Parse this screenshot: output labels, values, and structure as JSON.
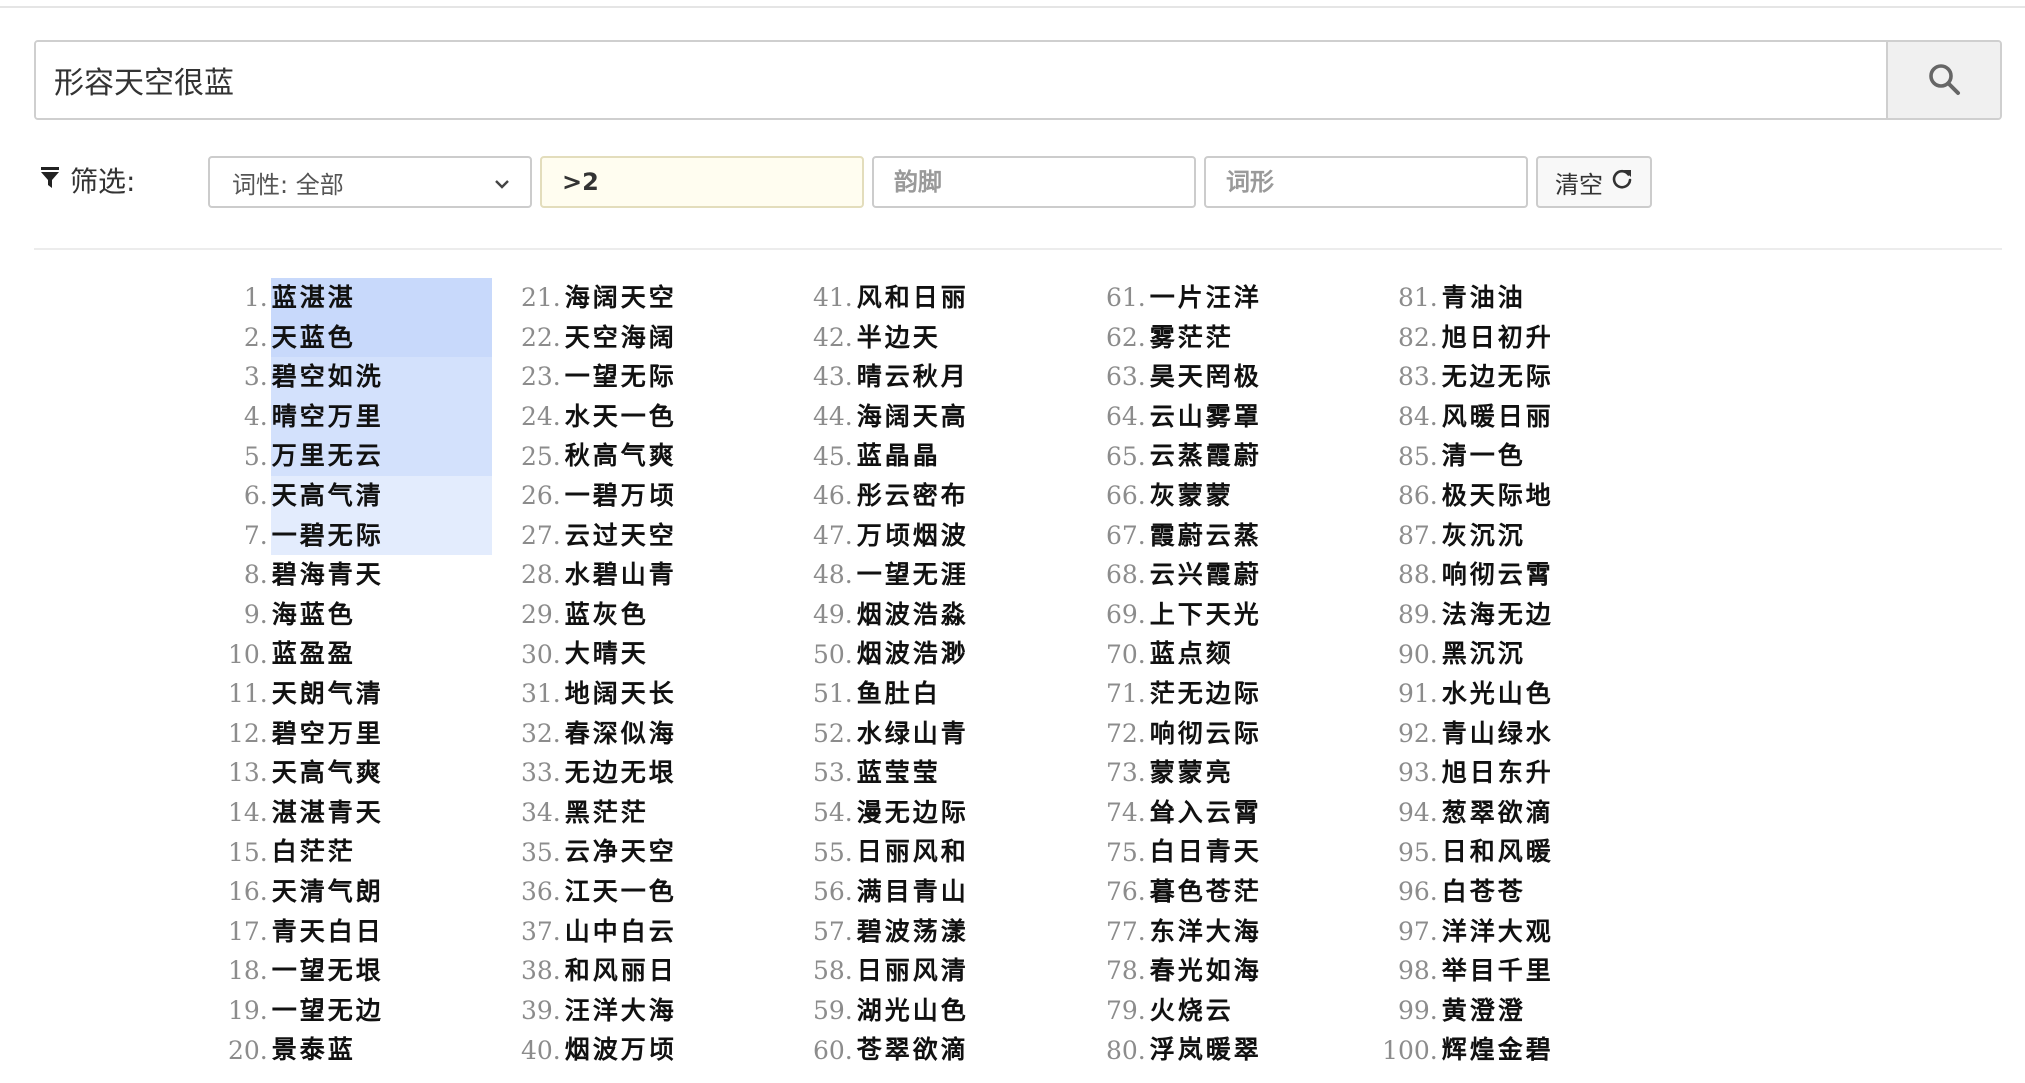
{
  "search": {
    "value": "形容天空很蓝",
    "button_icon": "search-icon"
  },
  "filter": {
    "label": "筛选:",
    "label_icon": "funnel-icon",
    "pos_select": {
      "selected": "词性: 全部"
    },
    "length_input": {
      "value": ">2",
      "placeholder": ""
    },
    "rhyme_input": {
      "value": "",
      "placeholder": "韵脚"
    },
    "form_input": {
      "value": "",
      "placeholder": "词形"
    },
    "clear_button": {
      "label": "清空",
      "icon": "refresh-icon"
    }
  },
  "colors": {
    "highlight_strong": "#c8d9fb",
    "highlight_medium": "#d3e1fc",
    "highlight_light": "#e3ecfd",
    "length_input_bg": "#fffdf0"
  },
  "results": [
    {
      "num": "1.",
      "word": "蓝湛湛",
      "hl": "strong"
    },
    {
      "num": "2.",
      "word": "天蓝色",
      "hl": "strong"
    },
    {
      "num": "3.",
      "word": "碧空如洗",
      "hl": "medium"
    },
    {
      "num": "4.",
      "word": "晴空万里",
      "hl": "medium"
    },
    {
      "num": "5.",
      "word": "万里无云",
      "hl": "medium"
    },
    {
      "num": "6.",
      "word": "天高气清",
      "hl": "light"
    },
    {
      "num": "7.",
      "word": "一碧无际",
      "hl": "light"
    },
    {
      "num": "8.",
      "word": "碧海青天"
    },
    {
      "num": "9.",
      "word": "海蓝色"
    },
    {
      "num": "10.",
      "word": "蓝盈盈"
    },
    {
      "num": "11.",
      "word": "天朗气清"
    },
    {
      "num": "12.",
      "word": "碧空万里"
    },
    {
      "num": "13.",
      "word": "天高气爽"
    },
    {
      "num": "14.",
      "word": "湛湛青天"
    },
    {
      "num": "15.",
      "word": "白茫茫"
    },
    {
      "num": "16.",
      "word": "天清气朗"
    },
    {
      "num": "17.",
      "word": "青天白日"
    },
    {
      "num": "18.",
      "word": "一望无垠"
    },
    {
      "num": "19.",
      "word": "一望无边"
    },
    {
      "num": "20.",
      "word": "景泰蓝"
    },
    {
      "num": "21.",
      "word": "海阔天空"
    },
    {
      "num": "22.",
      "word": "天空海阔"
    },
    {
      "num": "23.",
      "word": "一望无际"
    },
    {
      "num": "24.",
      "word": "水天一色"
    },
    {
      "num": "25.",
      "word": "秋高气爽"
    },
    {
      "num": "26.",
      "word": "一碧万顷"
    },
    {
      "num": "27.",
      "word": "云过天空"
    },
    {
      "num": "28.",
      "word": "水碧山青"
    },
    {
      "num": "29.",
      "word": "蓝灰色"
    },
    {
      "num": "30.",
      "word": "大晴天"
    },
    {
      "num": "31.",
      "word": "地阔天长"
    },
    {
      "num": "32.",
      "word": "春深似海"
    },
    {
      "num": "33.",
      "word": "无边无垠"
    },
    {
      "num": "34.",
      "word": "黑茫茫"
    },
    {
      "num": "35.",
      "word": "云净天空"
    },
    {
      "num": "36.",
      "word": "江天一色"
    },
    {
      "num": "37.",
      "word": "山中白云"
    },
    {
      "num": "38.",
      "word": "和风丽日"
    },
    {
      "num": "39.",
      "word": "汪洋大海"
    },
    {
      "num": "40.",
      "word": "烟波万顷"
    },
    {
      "num": "41.",
      "word": "风和日丽"
    },
    {
      "num": "42.",
      "word": "半边天"
    },
    {
      "num": "43.",
      "word": "晴云秋月"
    },
    {
      "num": "44.",
      "word": "海阔天高"
    },
    {
      "num": "45.",
      "word": "蓝晶晶"
    },
    {
      "num": "46.",
      "word": "彤云密布"
    },
    {
      "num": "47.",
      "word": "万顷烟波"
    },
    {
      "num": "48.",
      "word": "一望无涯"
    },
    {
      "num": "49.",
      "word": "烟波浩淼"
    },
    {
      "num": "50.",
      "word": "烟波浩渺"
    },
    {
      "num": "51.",
      "word": "鱼肚白"
    },
    {
      "num": "52.",
      "word": "水绿山青"
    },
    {
      "num": "53.",
      "word": "蓝莹莹"
    },
    {
      "num": "54.",
      "word": "漫无边际"
    },
    {
      "num": "55.",
      "word": "日丽风和"
    },
    {
      "num": "56.",
      "word": "满目青山"
    },
    {
      "num": "57.",
      "word": "碧波荡漾"
    },
    {
      "num": "58.",
      "word": "日丽风清"
    },
    {
      "num": "59.",
      "word": "湖光山色"
    },
    {
      "num": "60.",
      "word": "苍翠欲滴"
    },
    {
      "num": "61.",
      "word": "一片汪洋"
    },
    {
      "num": "62.",
      "word": "雾茫茫"
    },
    {
      "num": "63.",
      "word": "昊天罔极"
    },
    {
      "num": "64.",
      "word": "云山雾罩"
    },
    {
      "num": "65.",
      "word": "云蒸霞蔚"
    },
    {
      "num": "66.",
      "word": "灰蒙蒙"
    },
    {
      "num": "67.",
      "word": "霞蔚云蒸"
    },
    {
      "num": "68.",
      "word": "云兴霞蔚"
    },
    {
      "num": "69.",
      "word": "上下天光"
    },
    {
      "num": "70.",
      "word": "蓝点颏"
    },
    {
      "num": "71.",
      "word": "茫无边际"
    },
    {
      "num": "72.",
      "word": "响彻云际"
    },
    {
      "num": "73.",
      "word": "蒙蒙亮"
    },
    {
      "num": "74.",
      "word": "耸入云霄"
    },
    {
      "num": "75.",
      "word": "白日青天"
    },
    {
      "num": "76.",
      "word": "暮色苍茫"
    },
    {
      "num": "77.",
      "word": "东洋大海"
    },
    {
      "num": "78.",
      "word": "春光如海"
    },
    {
      "num": "79.",
      "word": "火烧云"
    },
    {
      "num": "80.",
      "word": "浮岚暖翠"
    },
    {
      "num": "81.",
      "word": "青油油"
    },
    {
      "num": "82.",
      "word": "旭日初升"
    },
    {
      "num": "83.",
      "word": "无边无际"
    },
    {
      "num": "84.",
      "word": "风暖日丽"
    },
    {
      "num": "85.",
      "word": "清一色"
    },
    {
      "num": "86.",
      "word": "极天际地"
    },
    {
      "num": "87.",
      "word": "灰沉沉"
    },
    {
      "num": "88.",
      "word": "响彻云霄"
    },
    {
      "num": "89.",
      "word": "法海无边"
    },
    {
      "num": "90.",
      "word": "黑沉沉"
    },
    {
      "num": "91.",
      "word": "水光山色"
    },
    {
      "num": "92.",
      "word": "青山绿水"
    },
    {
      "num": "93.",
      "word": "旭日东升"
    },
    {
      "num": "94.",
      "word": "葱翠欲滴"
    },
    {
      "num": "95.",
      "word": "日和风暖"
    },
    {
      "num": "96.",
      "word": "白苍苍"
    },
    {
      "num": "97.",
      "word": "洋洋大观"
    },
    {
      "num": "98.",
      "word": "举目千里"
    },
    {
      "num": "99.",
      "word": "黄澄澄"
    },
    {
      "num": "100.",
      "word": "辉煌金碧"
    }
  ]
}
